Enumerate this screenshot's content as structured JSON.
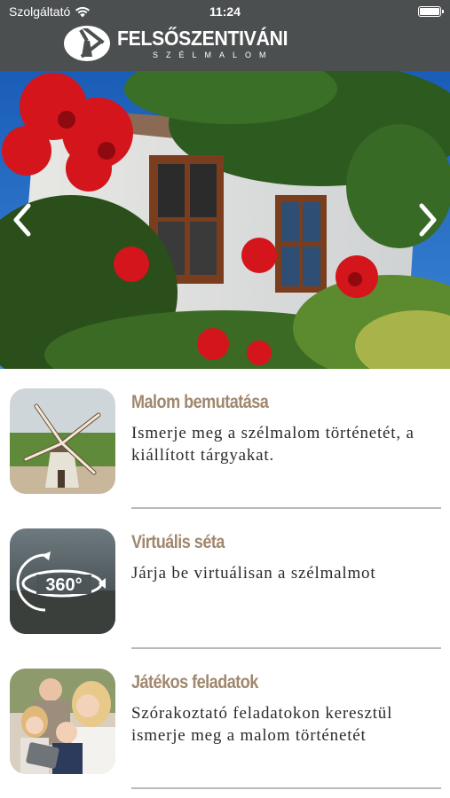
{
  "status_bar": {
    "carrier": "Szolgáltató",
    "time": "11:24",
    "battery_level": 1.0
  },
  "header": {
    "logo_title": "FELSŐSZENTIVÁNI",
    "logo_subtitle": "SZÉLMALOM",
    "background_color": "#4b4f4f"
  },
  "slider": {
    "prev_icon": "chevron-left-icon",
    "next_icon": "chevron-right-icon"
  },
  "menu": {
    "items": [
      {
        "title": "Malom bemutatása",
        "description": "Ismerje meg a szélmalom történetét, a kiállított tárgyakat.",
        "icon": "windmill-thumbnail"
      },
      {
        "title": "Virtuális séta",
        "description": "Járja be virtuálisan a szélmalmot",
        "icon": "360-tour-thumbnail",
        "badge": "360°"
      },
      {
        "title": "Játékos feladatok",
        "description": "Szórakoztató feladatokon keresztül ismerje meg a malom történetét",
        "icon": "family-thumbnail"
      }
    ],
    "title_color": "#a0876e",
    "text_color": "#2b2b2b"
  }
}
